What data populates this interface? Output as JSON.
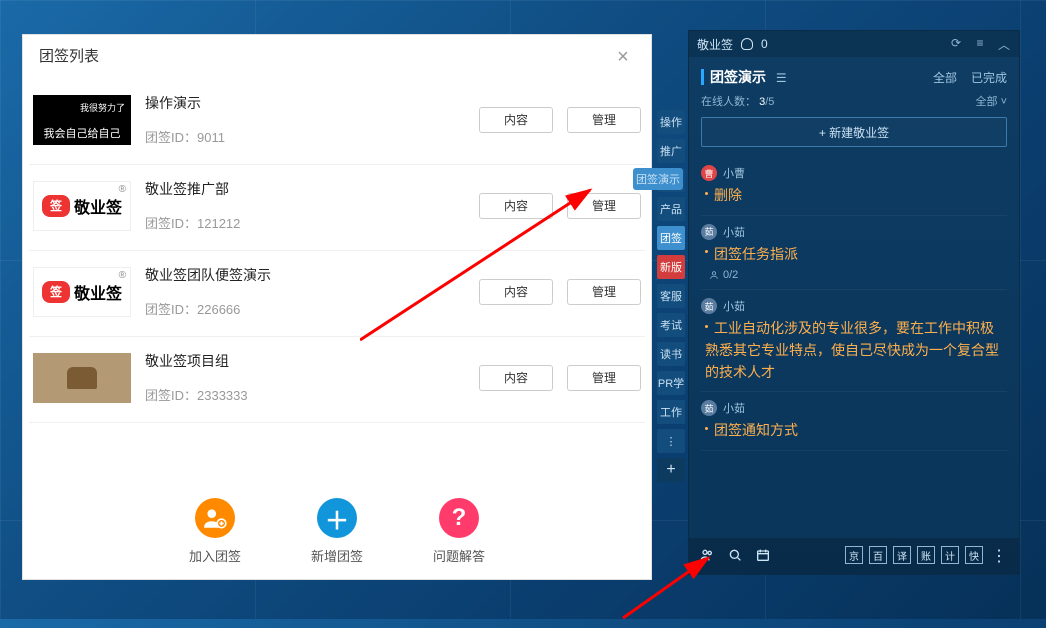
{
  "dialog": {
    "title": "团签列表",
    "rows": [
      {
        "thumb_l1": "我很努力了",
        "thumb_l2": "我会自己给自己",
        "title": "操作演示",
        "id_label": "团签ID：",
        "id": "9011",
        "btn_content": "内容",
        "btn_manage": "管理"
      },
      {
        "thumb_logo": "敬业签",
        "title": "敬业签推广部",
        "id_label": "团签ID：",
        "id": "121212",
        "btn_content": "内容",
        "btn_manage": "管理"
      },
      {
        "thumb_logo": "敬业签",
        "title": "敬业签团队便签演示",
        "id_label": "团签ID：",
        "id": "226666",
        "btn_content": "内容",
        "btn_manage": "管理"
      },
      {
        "title": "敬业签项目组",
        "id_label": "团签ID：",
        "id": "2333333",
        "btn_content": "内容",
        "btn_manage": "管理"
      }
    ],
    "footer": {
      "join": "加入团签",
      "add": "新增团签",
      "help": "问题解答"
    }
  },
  "sidetags": {
    "tooltip": "团签演示",
    "items": [
      "操作",
      "推广",
      "工作",
      "产品",
      "团签",
      "新版",
      "客服",
      "考试",
      "读书",
      "PR学",
      "工作",
      "⋮"
    ],
    "active_index": 4,
    "red_index": 5,
    "plus": "+"
  },
  "app": {
    "top": {
      "name": "敬业签",
      "bell_count": "0"
    },
    "header": {
      "title": "团签演示",
      "filter_all": "全部",
      "filter_done": "已完成"
    },
    "online": {
      "label": "在线人数：",
      "cur": "3",
      "total": "/5",
      "drop": "全部 ˅"
    },
    "new_btn": "+ 新建敬业签",
    "notes": [
      {
        "author": "小曹",
        "avatar": "a",
        "body": "删除"
      },
      {
        "author": "小茹",
        "avatar": "b",
        "body": "团签任务指派",
        "assignee": "0/2"
      },
      {
        "author": "小茹",
        "avatar": "b",
        "body": "工业自动化涉及的专业很多，要在工作中积极熟悉其它专业特点，使自己尽快成为一个复合型的技术人才"
      },
      {
        "author": "小茹",
        "avatar": "b",
        "body": "团签通知方式"
      }
    ],
    "bottom": {
      "right_sq": [
        "京",
        "百",
        "译",
        "账",
        "计",
        "快"
      ]
    }
  }
}
